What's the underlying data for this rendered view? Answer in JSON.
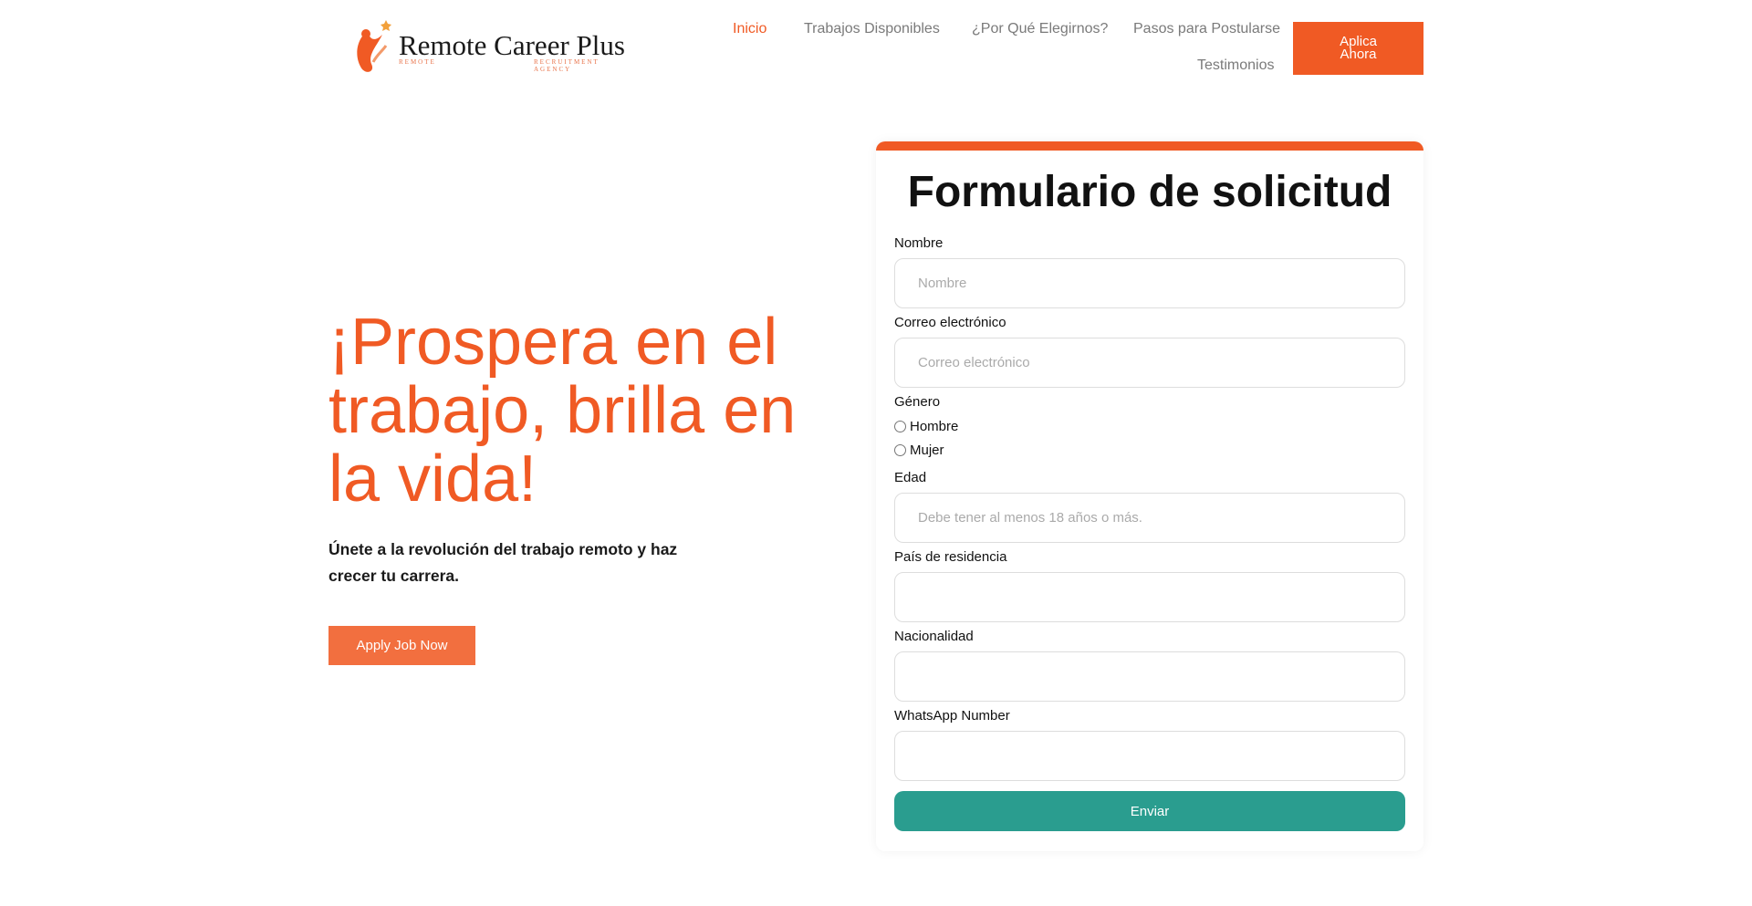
{
  "header": {
    "logo": {
      "title": "Remote Career Plus",
      "sub_left": "REMOTE",
      "sub_right": "RECRUITMENT AGENCY"
    },
    "nav": [
      "Inicio",
      "Trabajos Disponibles",
      "¿Por Qué Elegirnos?",
      "Pasos para Postularse",
      "Testimonios"
    ],
    "active_nav": "Inicio",
    "cta": "Aplica Ahora"
  },
  "hero": {
    "headline": "¡Prospera en el trabajo, brilla en la vida!",
    "subtitle": "Únete a la revolución del trabajo remoto y haz crecer tu carrera.",
    "button": "Apply Job Now"
  },
  "form": {
    "title": "Formulario de solicitud",
    "name_label": "Nombre",
    "name_placeholder": "Nombre",
    "email_label": "Correo electrónico",
    "email_placeholder": "Correo electrónico",
    "gender_label": "Género",
    "gender_options": [
      "Hombre",
      "Mujer"
    ],
    "age_label": "Edad",
    "age_placeholder": "Debe tener al menos 18 años o más.",
    "country_label": "País de residencia",
    "nationality_label": "Nacionalidad",
    "whatsapp_label": "WhatsApp Number",
    "submit": "Enviar"
  },
  "colors": {
    "accent": "#f05a24",
    "submit": "#2a9d8f"
  }
}
